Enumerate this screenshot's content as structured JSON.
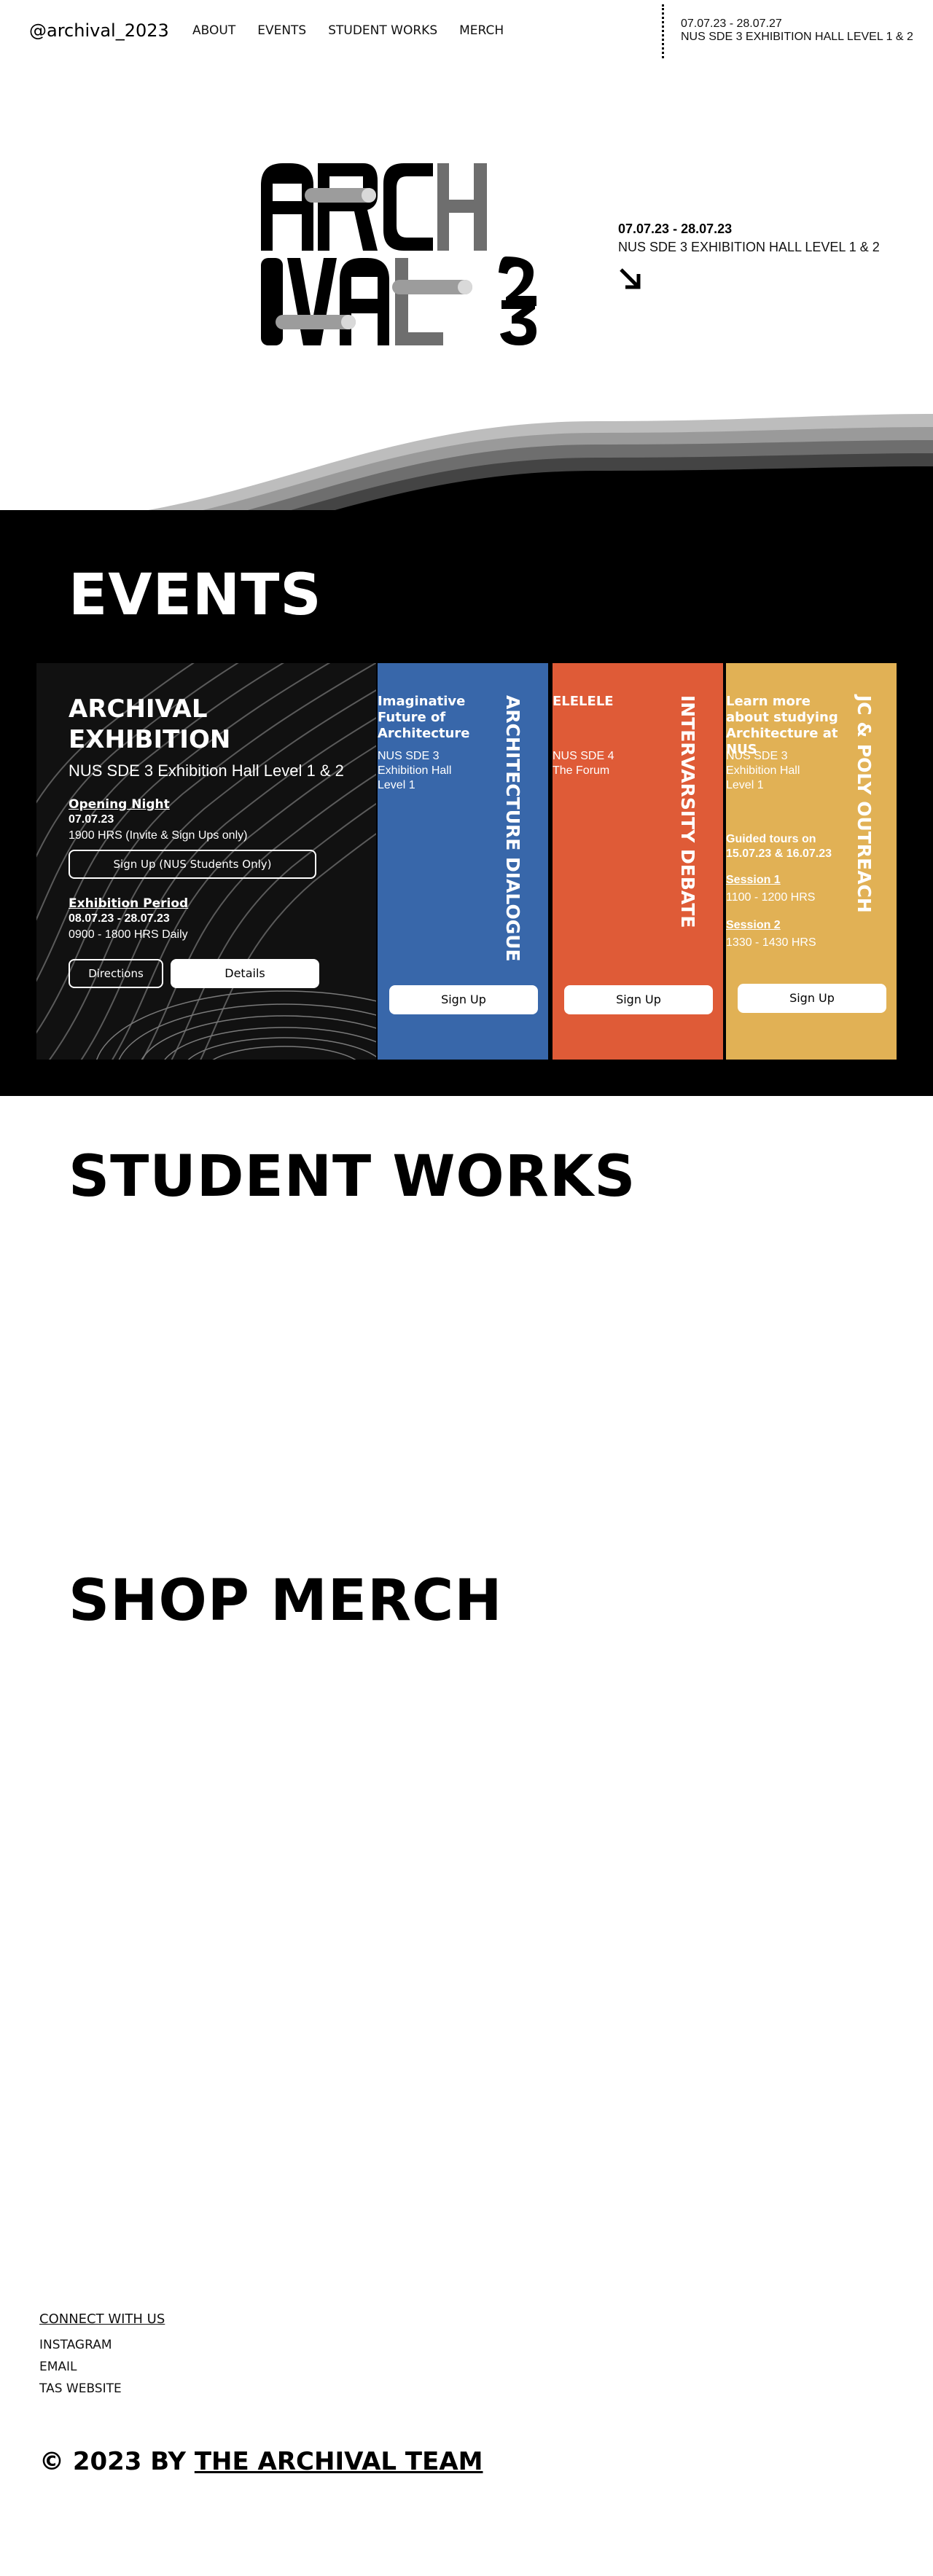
{
  "header": {
    "brand": "@archival_2023",
    "nav": [
      "ABOUT",
      "EVENTS",
      "STUDENT WORKS",
      "MERCH"
    ],
    "date": "07.07.23 - 28.07.27",
    "venue": "NUS SDE 3 EXHIBITION HALL LEVEL 1 & 2"
  },
  "hero": {
    "logo_text": "ARCHIVAL 23",
    "date": "07.07.23 - 28.07.23",
    "venue": "NUS SDE 3 EXHIBITION HALL LEVEL 1 & 2",
    "arrow_icon": "arrow-down-right-icon",
    "wave_colors": [
      "#bdbdbd",
      "#9a9a9a",
      "#6e6e6e",
      "#444444",
      "#000000"
    ]
  },
  "events": {
    "title": "EVENTS",
    "main": {
      "title": "ARCHIVAL EXHIBITION",
      "venue": "NUS SDE 3 Exhibition Hall Level 1 & 2",
      "opening_heading": "Opening Night",
      "opening_date": "07.07.23",
      "opening_time": "1900 HRS (Invite & Sign Ups only)",
      "signup_label": "Sign Up (NUS Students Only)",
      "period_heading": "Exhibition Period",
      "period_dates": "08.07.23 - 28.07.23",
      "period_time": "0900 - 1800 HRS Daily",
      "directions_label": "Directions",
      "details_label": "Details"
    },
    "architecture": {
      "color": "#3867aa",
      "lead": "Imaginative Future of Architecture",
      "venue": "NUS SDE 3 Exhibition Hall Level 1",
      "vertical_title": "ARCHITECTURE DIALOGUE",
      "signup_label": "Sign Up"
    },
    "debate": {
      "color": "#df5b37",
      "lead": "ELELELE",
      "venue": "NUS SDE 4 The Forum",
      "vertical_title": "INTERVARSITY DEBATE",
      "signup_label": "Sign Up"
    },
    "outreach": {
      "color": "#e1b155",
      "lead": "Learn more about studying Architecture at NUS",
      "venue": "NUS SDE 3 Exhibition Hall Level 1",
      "tours": "Guided tours on 15.07.23 & 16.07.23",
      "session1_heading": "Session 1",
      "session1_time": "1100 - 1200 HRS",
      "session2_heading": "Session 2",
      "session2_time": "1330 - 1430 HRS",
      "vertical_title": "JC & POLY OUTREACH",
      "signup_label": "Sign Up"
    }
  },
  "student_works": {
    "title": "STUDENT WORKS"
  },
  "merch": {
    "title": "SHOP MERCH"
  },
  "footer": {
    "connect": "CONNECT WITH US",
    "links": [
      "INSTAGRAM",
      "EMAIL",
      "TAS WEBSITE"
    ],
    "copyright_prefix": "© 2023 BY",
    "team": "THE ARCHIVAL TEAM"
  }
}
